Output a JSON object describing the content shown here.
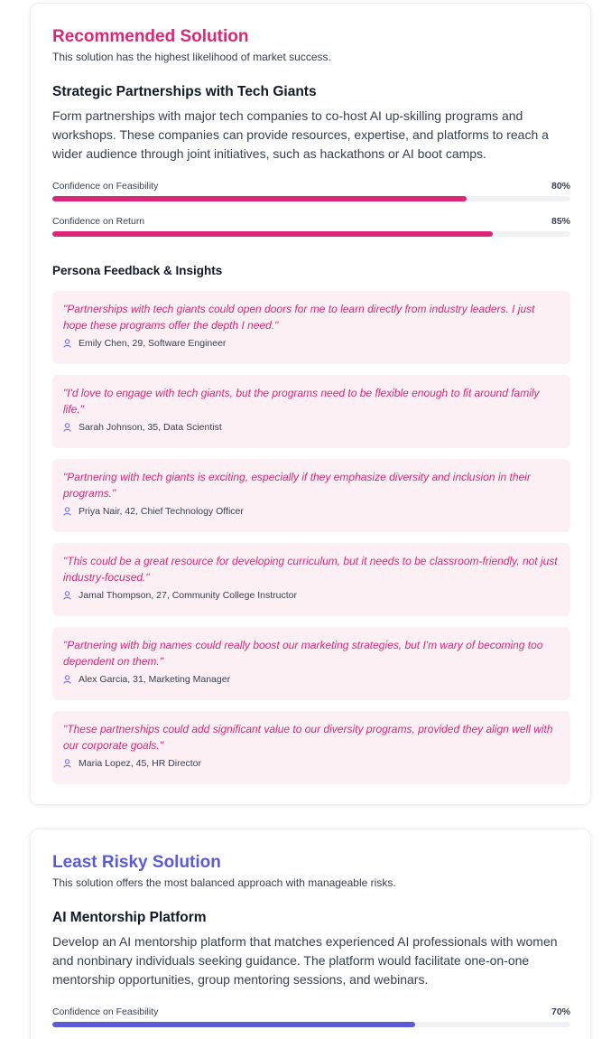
{
  "recommended": {
    "heading": "Recommended Solution",
    "subheading": "This solution has the highest likelihood of market success.",
    "accent_color": "#db2777",
    "title": "Strategic Partnerships with Tech Giants",
    "description": "Form partnerships with major tech companies to co-host AI up-skilling programs and workshops. These companies can provide resources, expertise, and platforms to reach a wider audience through joint initiatives, such as hackathons or AI boot camps.",
    "metrics": [
      {
        "label": "Confidence on Feasibility",
        "value": "80%",
        "fraction": 0.8
      },
      {
        "label": "Confidence on Return",
        "value": "85%",
        "fraction": 0.85
      }
    ],
    "feedback_title": "Persona Feedback & Insights",
    "person_icon": "person-icon",
    "feedback": [
      {
        "quote": "\"Partnerships with tech giants could open doors for me to learn directly from industry leaders. I just hope these programs offer the depth I need.\"",
        "persona": "Emily Chen, 29, Software Engineer"
      },
      {
        "quote": "\"I'd love to engage with tech giants, but the programs need to be flexible enough to fit around family life.\"",
        "persona": "Sarah Johnson, 35, Data Scientist"
      },
      {
        "quote": "\"Partnering with tech giants is exciting, especially if they emphasize diversity and inclusion in their programs.\"",
        "persona": "Priya Nair, 42, Chief Technology Officer"
      },
      {
        "quote": "\"This could be a great resource for developing curriculum, but it needs to be classroom-friendly, not just industry-focused.\"",
        "persona": "Jamal Thompson, 27, Community College Instructor"
      },
      {
        "quote": "\"Partnering with big names could really boost our marketing strategies, but I'm wary of becoming too dependent on them.\"",
        "persona": "Alex Garcia, 31, Marketing Manager"
      },
      {
        "quote": "\"These partnerships could add significant value to our diversity programs, provided they align well with our corporate goals.\"",
        "persona": "Maria Lopez, 45, HR Director"
      }
    ]
  },
  "least_risky": {
    "heading": "Least Risky Solution",
    "subheading": "This solution offers the most balanced approach with manageable risks.",
    "accent_color": "#5b5bd6",
    "title": "AI Mentorship Platform",
    "description": "Develop an AI mentorship platform that matches experienced AI professionals with women and nonbinary individuals seeking guidance. The platform would facilitate one-on-one mentorship opportunities, group mentoring sessions, and webinars.",
    "metrics": [
      {
        "label": "Confidence on Feasibility",
        "value": "70%",
        "fraction": 0.7
      }
    ]
  }
}
